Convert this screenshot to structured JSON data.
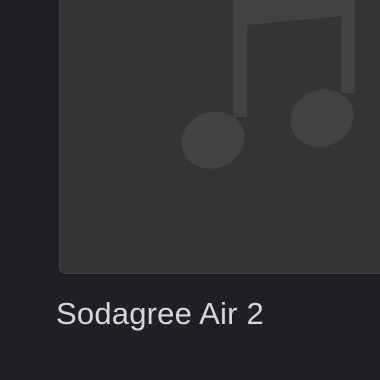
{
  "album": {
    "title": "Sodagree Air 2",
    "artwork_placeholder_icon": "music-note-icon",
    "artwork_present": false
  },
  "colors": {
    "background": "#1f2023",
    "tile": "#333436",
    "icon": "#414244",
    "title_text": "#d7d7d9"
  }
}
